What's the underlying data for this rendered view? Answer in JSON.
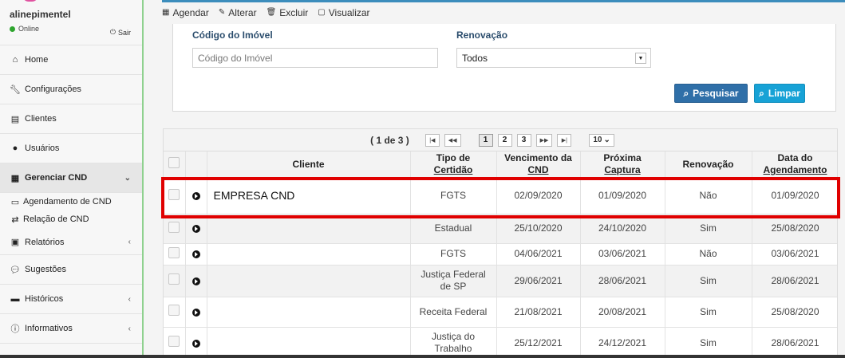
{
  "user": {
    "name": "alinepimentel",
    "status": "Online",
    "logout_label": "Sair"
  },
  "sidebar": {
    "items": [
      {
        "label": "Home",
        "icon": "home-icon"
      },
      {
        "label": "Configurações",
        "icon": "wrench-icon"
      },
      {
        "label": "Clientes",
        "icon": "clipboard-icon"
      },
      {
        "label": "Usuários",
        "icon": "user-icon"
      },
      {
        "label": "Gerenciar CND",
        "icon": "calendar-icon"
      },
      {
        "label": "Relatórios",
        "icon": "report-icon"
      },
      {
        "label": "Sugestões",
        "icon": "comments-icon"
      },
      {
        "label": "Históricos",
        "icon": "history-icon"
      },
      {
        "label": "Informativos",
        "icon": "info-icon"
      }
    ],
    "subitems": [
      {
        "label": "Agendamento de CND",
        "icon": "calendar-outline-icon"
      },
      {
        "label": "Relação de CND",
        "icon": "retweet-icon"
      }
    ]
  },
  "toolbar": {
    "schedule_label": "Agendar",
    "edit_label": "Alterar",
    "delete_label": "Excluir",
    "view_label": "Visualizar"
  },
  "filters": {
    "property_code": {
      "label": "Código do Imóvel",
      "placeholder": "Código do Imóvel"
    },
    "renewal": {
      "label": "Renovação",
      "value": "Todos"
    },
    "search_label": "Pesquisar",
    "clear_label": "Limpar"
  },
  "pager": {
    "info": "( 1 de 3 )",
    "first": "|◀",
    "prev": "◀◀",
    "pages": [
      "1",
      "2",
      "3"
    ],
    "next": "▶▶",
    "last": "▶|",
    "page_size": "10"
  },
  "table": {
    "headers": {
      "client": "Cliente",
      "cert_type_1": "Tipo de",
      "cert_type_2": "Certidão",
      "due_1": "Vencimento da",
      "due_2": "CND",
      "next_1": "Próxima",
      "next_2": "Captura",
      "renewal": "Renovação",
      "sched_1": "Data do",
      "sched_2": "Agendamento"
    },
    "rows": [
      {
        "client": "EMPRESA CND",
        "type_1": "FGTS",
        "type_2": "",
        "due": "02/09/2020",
        "next": "01/09/2020",
        "renewal": "Não",
        "scheduled": "01/09/2020"
      },
      {
        "client": "",
        "type_1": "Estadual",
        "type_2": "",
        "due": "25/10/2020",
        "next": "24/10/2020",
        "renewal": "Sim",
        "scheduled": "25/08/2020"
      },
      {
        "client": "",
        "type_1": "FGTS",
        "type_2": "",
        "due": "04/06/2021",
        "next": "03/06/2021",
        "renewal": "Não",
        "scheduled": "03/06/2021"
      },
      {
        "client": "",
        "type_1": "Justiça Federal",
        "type_2": "de SP",
        "due": "29/06/2021",
        "next": "28/06/2021",
        "renewal": "Sim",
        "scheduled": "28/06/2021"
      },
      {
        "client": "",
        "type_1": "Receita Federal",
        "type_2": "",
        "due": "21/08/2021",
        "next": "20/08/2021",
        "renewal": "Sim",
        "scheduled": "25/08/2020"
      },
      {
        "client": "",
        "type_1": "Justiça do",
        "type_2": "Trabalho",
        "due": "25/12/2021",
        "next": "24/12/2021",
        "renewal": "Sim",
        "scheduled": "28/06/2021"
      }
    ]
  },
  "colors": {
    "accent": "#3c8dbc",
    "search_button": "#2f6fa8",
    "clear_button": "#17a2d6",
    "highlight": "#e00000",
    "online": "#2ea52e"
  }
}
